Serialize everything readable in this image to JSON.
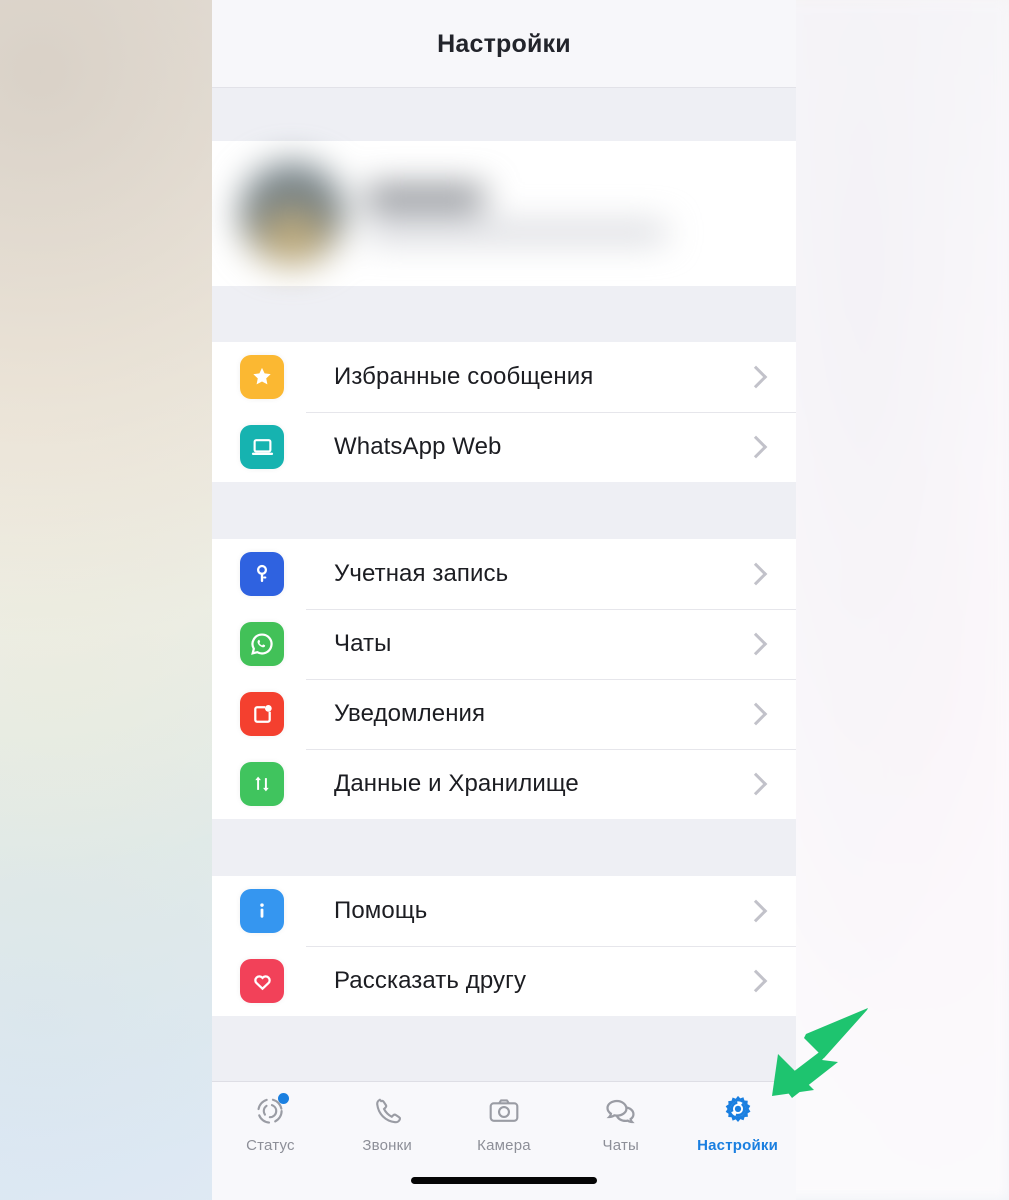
{
  "header": {
    "title": "Настройки"
  },
  "profile": {
    "blurred": true,
    "avatar_icon": "avatar-image"
  },
  "sections": [
    {
      "rows": [
        {
          "label": "Избранные сообщения",
          "icon": "star-icon",
          "icon_color": "#fbb832",
          "chevron": "chevron-right-icon"
        },
        {
          "label": "WhatsApp Web",
          "icon": "laptop-icon",
          "icon_color": "#16b3b0",
          "chevron": "chevron-right-icon"
        }
      ]
    },
    {
      "rows": [
        {
          "label": "Учетная запись",
          "icon": "key-icon",
          "icon_color": "#2f62e0",
          "chevron": "chevron-right-icon"
        },
        {
          "label": "Чаты",
          "icon": "whatsapp-chat-icon",
          "icon_color": "#42c158",
          "chevron": "chevron-right-icon"
        },
        {
          "label": "Уведомления",
          "icon": "notification-icon",
          "icon_color": "#f4402f",
          "chevron": "chevron-right-icon"
        },
        {
          "label": "Данные и Хранилище",
          "icon": "data-arrows-icon",
          "icon_color": "#40c45e",
          "chevron": "chevron-right-icon"
        }
      ]
    },
    {
      "rows": [
        {
          "label": "Помощь",
          "icon": "info-icon",
          "icon_color": "#3596f0",
          "chevron": "chevron-right-icon"
        },
        {
          "label": "Рассказать другу",
          "icon": "heart-icon",
          "icon_color": "#f24159",
          "chevron": "chevron-right-icon"
        }
      ]
    }
  ],
  "tabs": [
    {
      "label": "Статус",
      "icon": "status-ring-icon",
      "active": false,
      "badge": true
    },
    {
      "label": "Звонки",
      "icon": "phone-icon",
      "active": false,
      "badge": false
    },
    {
      "label": "Камера",
      "icon": "camera-icon",
      "active": false,
      "badge": false
    },
    {
      "label": "Чаты",
      "icon": "chat-bubbles-icon",
      "active": false,
      "badge": false
    },
    {
      "label": "Настройки",
      "icon": "gear-icon",
      "active": true,
      "badge": false
    }
  ],
  "annotation": {
    "arrow_icon": "green-arrow-down-left",
    "arrow_color": "#1ec46f",
    "points_to": "Настройки"
  },
  "colors": {
    "accent_blue": "#1a7fe0",
    "tab_inactive": "#8d8f98",
    "band": "#eeeff4",
    "screen": "#ffffff"
  }
}
